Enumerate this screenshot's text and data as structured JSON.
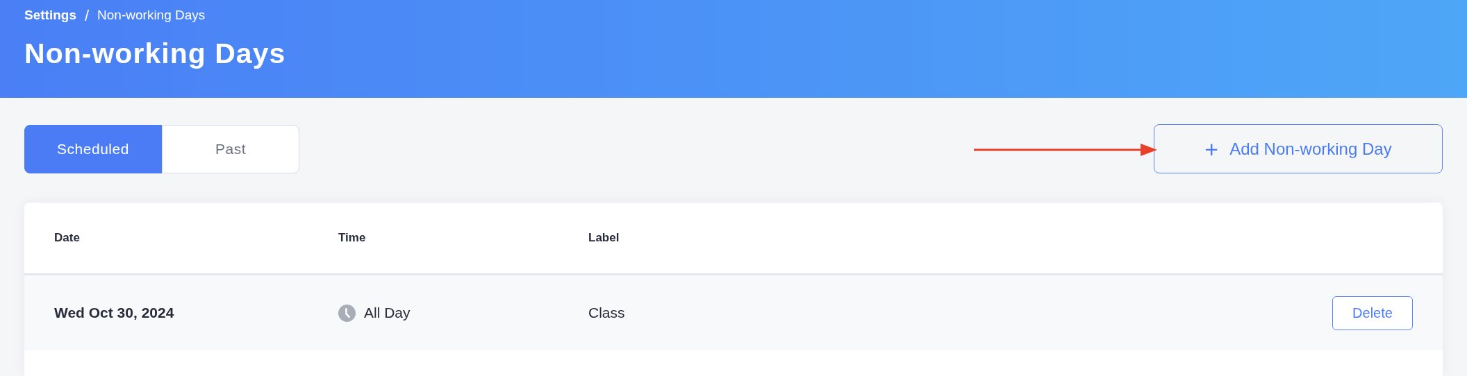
{
  "breadcrumb": [
    {
      "label": "Settings",
      "current": false
    },
    {
      "label": "Non-working Days",
      "current": true
    }
  ],
  "breadcrumb_separator": "/",
  "title": "Non-working Days",
  "tabs": [
    {
      "label": "Scheduled",
      "selected": true
    },
    {
      "label": "Past",
      "selected": false
    }
  ],
  "add_button": {
    "icon": "+",
    "label": "Add Non-working Day"
  },
  "table": {
    "columns": [
      "Date",
      "Time",
      "Label"
    ],
    "rows": [
      {
        "date": "Wed Oct 30, 2024",
        "time": "All Day",
        "label": "Class",
        "action": "Delete"
      }
    ]
  }
}
